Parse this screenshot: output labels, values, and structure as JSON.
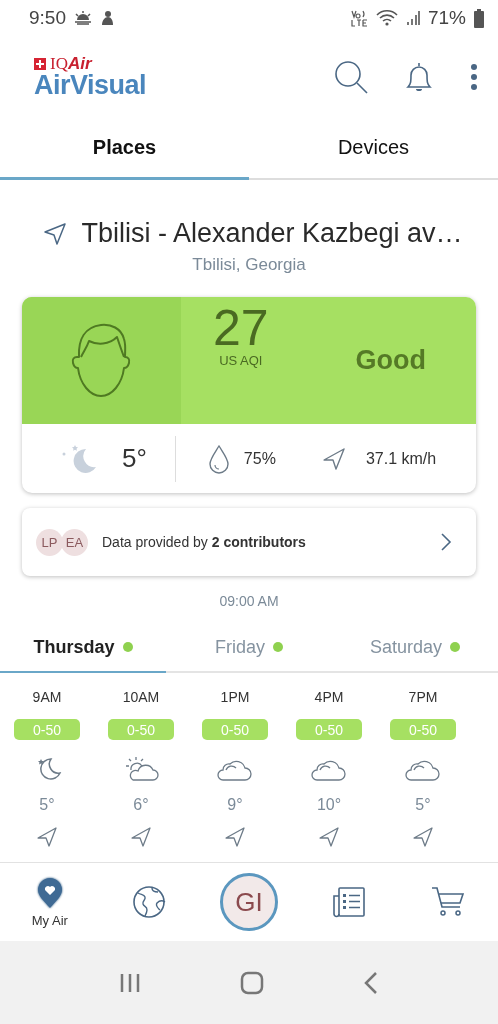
{
  "status_bar": {
    "time": "9:50",
    "battery": "71%"
  },
  "header": {
    "brand": "IQ",
    "brand_italic": "Air",
    "app_name": "AirVisual"
  },
  "tabs": [
    {
      "label": "Places",
      "selected": true
    },
    {
      "label": "Devices",
      "selected": false
    }
  ],
  "location": {
    "name": "Tbilisi - Alexander Kazbegi av…",
    "region": "Tbilisi, Georgia"
  },
  "aqi_card": {
    "value": "27",
    "unit": "US AQI",
    "category": "Good",
    "temperature": "5°",
    "humidity": "75%",
    "wind": "37.1 km/h"
  },
  "contributors": {
    "avatars": [
      "LP",
      "EA"
    ],
    "text": "Data provided by **2 contributors**"
  },
  "updated_time": "09:00 AM",
  "day_tabs": [
    {
      "label": "Thursday",
      "selected": true,
      "color": "#8fd14f"
    },
    {
      "label": "Friday",
      "selected": false,
      "color": "#8fd14f"
    },
    {
      "label": "Saturday",
      "selected": false,
      "color": "#8fd14f"
    }
  ],
  "hours": [
    {
      "time": "9AM",
      "aqi": "0-50",
      "kind": "moon",
      "temp": "5°"
    },
    {
      "time": "10AM",
      "aqi": "0-50",
      "kind": "sun-cloud",
      "temp": "6°"
    },
    {
      "time": "1PM",
      "aqi": "0-50",
      "kind": "cloud",
      "temp": "9°"
    },
    {
      "time": "4PM",
      "aqi": "0-50",
      "kind": "cloud",
      "temp": "10°"
    },
    {
      "time": "7PM",
      "aqi": "0-50",
      "kind": "cloud",
      "temp": "5°"
    }
  ],
  "bottom_nav": [
    {
      "kind": "heart-pin",
      "label": "My Air",
      "selected": true
    },
    {
      "kind": "globe",
      "selected": false
    },
    {
      "kind": "avatar",
      "label": "GI",
      "selected": false
    },
    {
      "kind": "news",
      "selected": false
    },
    {
      "kind": "cart",
      "selected": false
    }
  ]
}
